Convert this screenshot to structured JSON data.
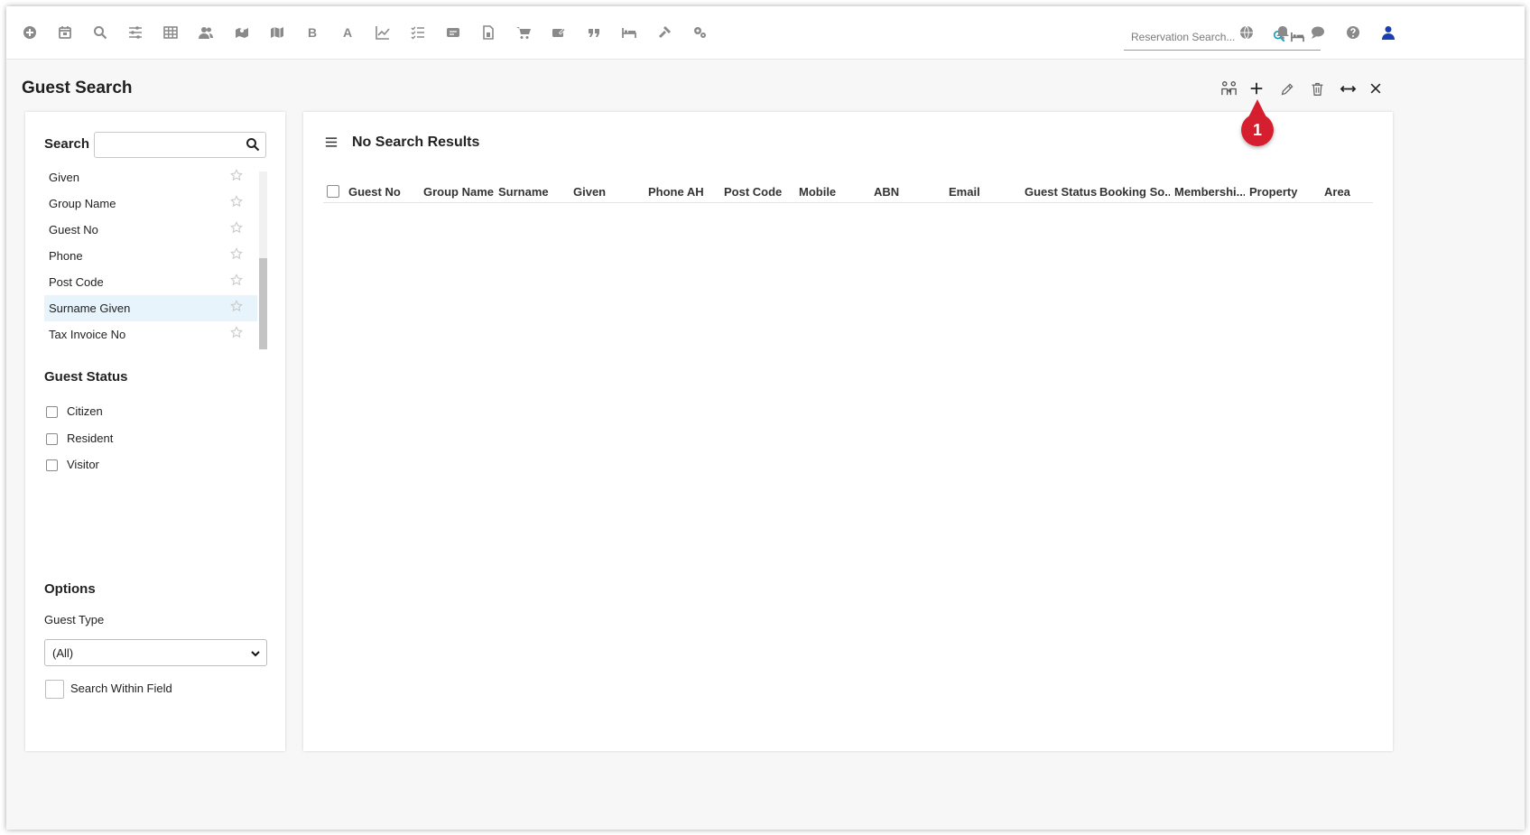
{
  "toolbar": {
    "icons": [
      "add-circle-icon",
      "calendar-icon",
      "search-icon",
      "sliders-icon",
      "grid-icon",
      "users-icon",
      "map-pin-icon",
      "map-icon",
      "bold-icon",
      "font-icon",
      "line-chart-icon",
      "checklist-icon",
      "card-icon",
      "document-icon",
      "cart-icon",
      "ticket-icon",
      "quote-icon",
      "bed-icon",
      "hammer-icon",
      "cogs-icon"
    ],
    "bold_glyph": "B",
    "font_glyph": "A",
    "reservation_search_placeholder": "Reservation Search...",
    "right_icons": [
      "globe-icon",
      "bell-icon",
      "chat-icon",
      "help-icon",
      "user-icon"
    ]
  },
  "page": {
    "title": "Guest Search",
    "actions": [
      "merge-guests-icon",
      "add-icon",
      "edit-icon",
      "delete-icon",
      "expand-icon",
      "close-icon"
    ]
  },
  "search_panel": {
    "search_label": "Search",
    "search_value": "",
    "fields": [
      {
        "label": "Given",
        "selected": false
      },
      {
        "label": "Group Name",
        "selected": false
      },
      {
        "label": "Guest No",
        "selected": false
      },
      {
        "label": "Phone",
        "selected": false
      },
      {
        "label": "Post Code",
        "selected": false
      },
      {
        "label": "Surname Given",
        "selected": true
      },
      {
        "label": "Tax Invoice No",
        "selected": false
      }
    ],
    "guest_status_title": "Guest Status",
    "guest_status_options": [
      "Citizen",
      "Resident",
      "Visitor"
    ],
    "options_title": "Options",
    "guest_type_label": "Guest Type",
    "guest_type_value": "(All)",
    "search_within_label": "Search Within Field"
  },
  "results": {
    "title": "No Search Results",
    "columns": [
      "Guest No",
      "Group Name",
      "Surname",
      "Given",
      "Phone AH",
      "Post Code",
      "Mobile",
      "ABN",
      "Email",
      "Guest Status",
      "Booking So...",
      "Membershi...",
      "Property",
      "Area"
    ]
  },
  "callout": {
    "number": "1",
    "color": "#d61f2e"
  },
  "colors": {
    "accent": "#1a3fb3",
    "search_teal": "#1aa3b8",
    "selected_row": "#e8f4fb"
  }
}
